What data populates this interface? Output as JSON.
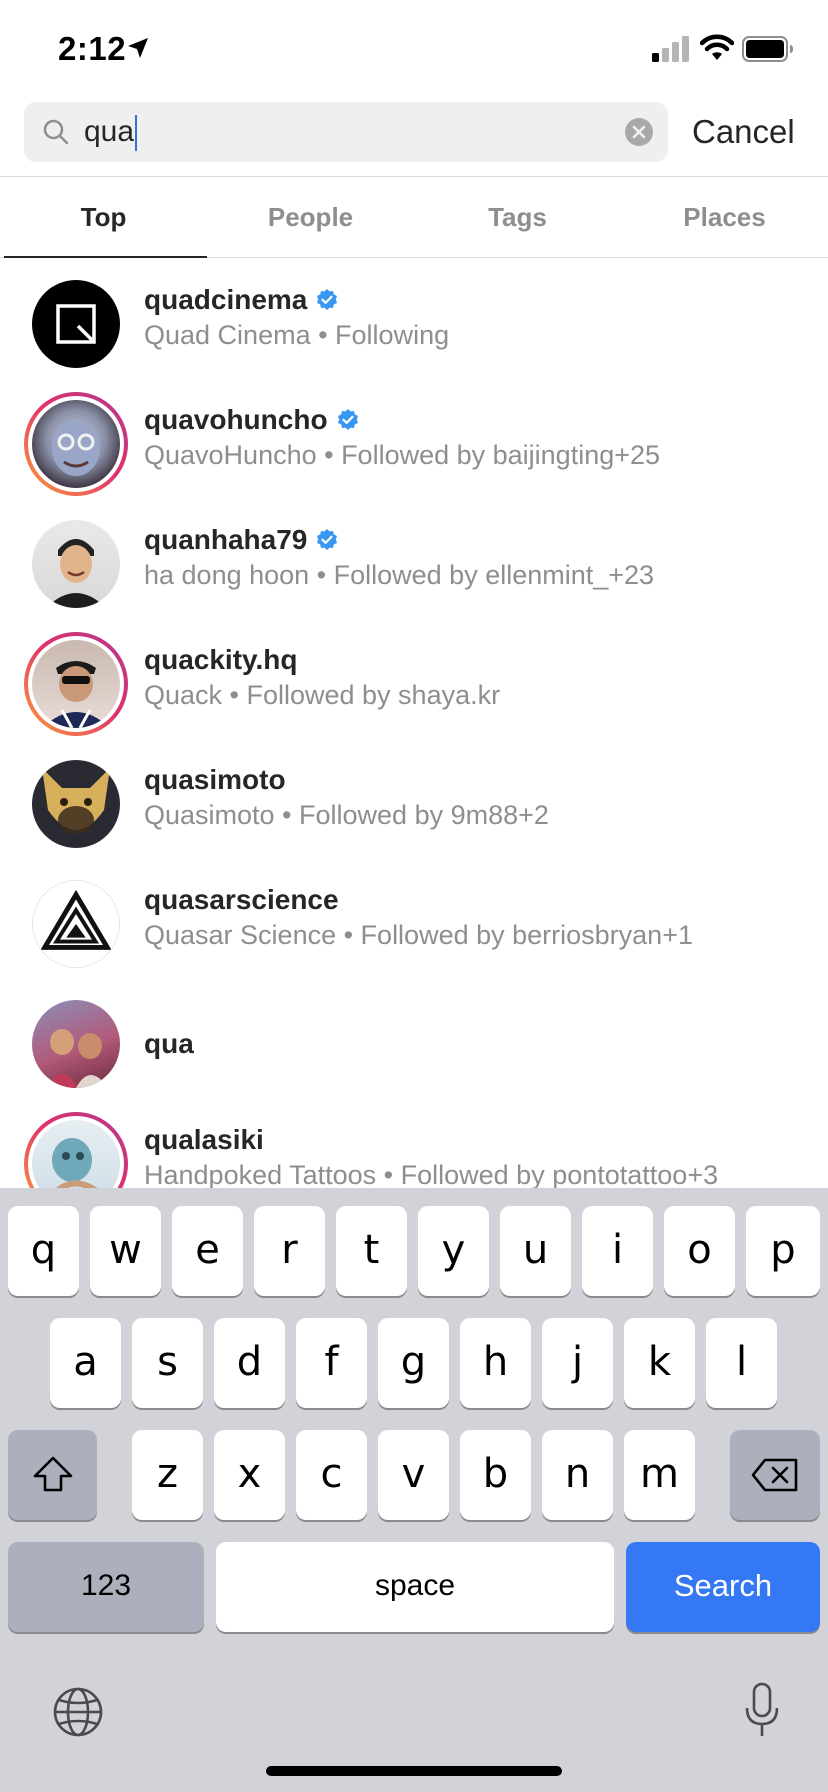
{
  "status_bar": {
    "time": "2:12"
  },
  "search": {
    "query": "qua",
    "cancel_label": "Cancel"
  },
  "tabs": [
    {
      "label": "Top",
      "active": true
    },
    {
      "label": "People",
      "active": false
    },
    {
      "label": "Tags",
      "active": false
    },
    {
      "label": "Places",
      "active": false
    }
  ],
  "results": [
    {
      "username": "quadcinema",
      "verified": true,
      "subtitle": "Quad Cinema • Following"
    },
    {
      "username": "quavohuncho",
      "verified": true,
      "subtitle": "QuavoHuncho • Followed by baijingting+25"
    },
    {
      "username": "quanhaha79",
      "verified": true,
      "subtitle": "ha dong hoon • Followed by ellenmint_+23"
    },
    {
      "username": "quackity.hq",
      "verified": false,
      "subtitle": "Quack • Followed by shaya.kr"
    },
    {
      "username": "quasimoto",
      "verified": false,
      "subtitle": "Quasimoto • Followed by 9m88+2"
    },
    {
      "username": "quasarscience",
      "verified": false,
      "subtitle": "Quasar Science • Followed by berriosbryan+1"
    },
    {
      "username": "qua",
      "verified": false,
      "subtitle": ""
    },
    {
      "username": "qualasiki",
      "verified": false,
      "subtitle": "Handpoked Tattoos • Followed by pontotattoo+3"
    }
  ],
  "keyboard": {
    "row1": [
      "q",
      "w",
      "e",
      "r",
      "t",
      "y",
      "u",
      "i",
      "o",
      "p"
    ],
    "row2": [
      "a",
      "s",
      "d",
      "f",
      "g",
      "h",
      "j",
      "k",
      "l"
    ],
    "row3": [
      "z",
      "x",
      "c",
      "v",
      "b",
      "n",
      "m"
    ],
    "numbers_label": "123",
    "space_label": "space",
    "search_label": "Search"
  },
  "colors": {
    "accent_blue": "#3478f6",
    "verified_blue": "#3897f0",
    "muted": "#8e8e8e"
  }
}
